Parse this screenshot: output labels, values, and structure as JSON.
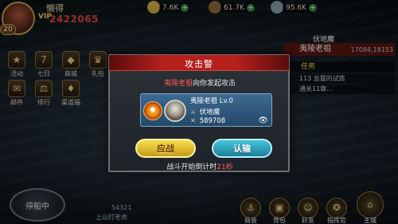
{
  "top_left": {
    "player_name": "懒得",
    "vip_label": "VIP",
    "power_value": "2422065",
    "level": "20"
  },
  "resources": [
    {
      "name": "food",
      "value": "7.6K",
      "color": "#d9b246"
    },
    {
      "name": "wood",
      "value": "61.7K",
      "color": "#8f6b3c"
    },
    {
      "name": "iron",
      "value": "95.6K",
      "color": "#8aa0b0"
    }
  ],
  "left_menu": [
    {
      "label": "活动",
      "icon": "★"
    },
    {
      "label": "七日",
      "icon": "7"
    },
    {
      "label": "商城",
      "icon": "◆"
    },
    {
      "label": "礼包",
      "icon": "♛"
    },
    {
      "label": "邮件",
      "icon": "✉"
    },
    {
      "label": "排行",
      "icon": "⚖"
    },
    {
      "label": "渠道福",
      "icon": "♦"
    }
  ],
  "right_panel": {
    "map_title": "夷陵老祖",
    "sub_title": "伏地魔",
    "coords": "17084,18153",
    "task_header": "任务",
    "task_lines": [
      "113 总督的试炼",
      "通关11章..."
    ]
  },
  "bottom": {
    "sail_label": "停船中",
    "chat_line_1": "54321",
    "chat_line_2": "上山打老虎",
    "items": [
      {
        "label": "商会",
        "icon": "⚓"
      },
      {
        "label": "背包",
        "icon": "▣"
      },
      {
        "label": "好友",
        "icon": "☺"
      },
      {
        "label": "指挥官",
        "icon": "✪"
      },
      {
        "label": "主城",
        "icon": "⌂"
      }
    ]
  },
  "modal": {
    "title": "攻击警",
    "attacker_name": "夷陵老祖",
    "attack_message": "向你发起攻击",
    "enemy": {
      "name_level": "夷陵老祖 Lv.0",
      "guild": "伏地魔",
      "power": "589708",
      "guild_icon": "⚔",
      "power_icon": "✕",
      "eye_icon": "👁"
    },
    "fight_label": "应战",
    "surrender_label": "认输",
    "countdown_prefix": "战斗开始倒计时",
    "countdown_seconds": "21秒"
  }
}
